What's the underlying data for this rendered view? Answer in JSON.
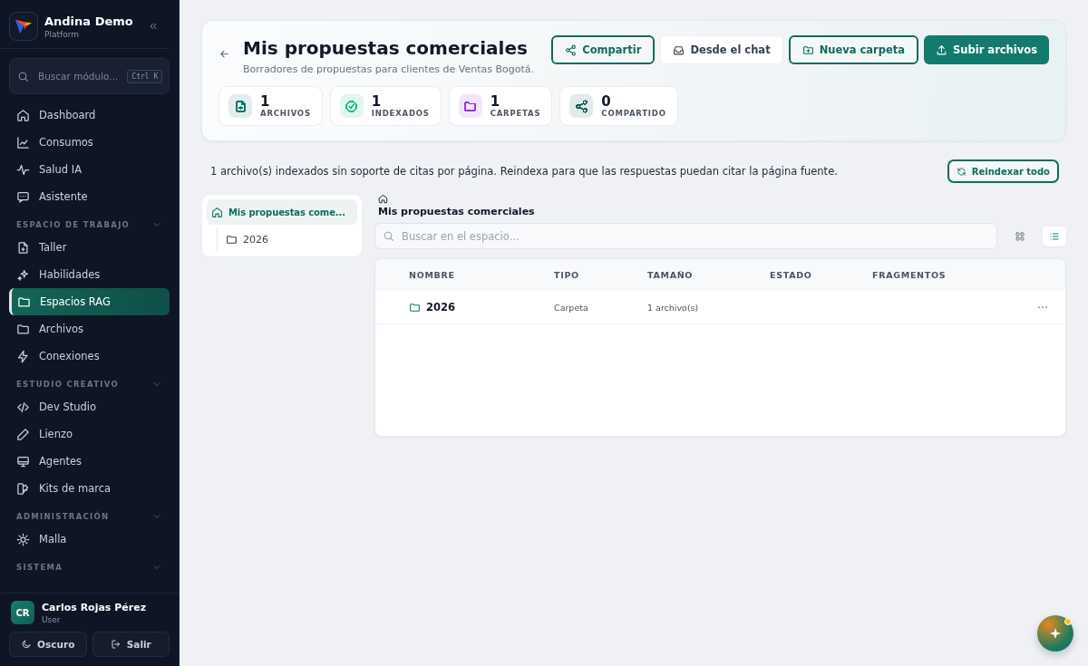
{
  "brand": {
    "name": "Andina Demo",
    "subtitle": "Platform"
  },
  "sidebar": {
    "search": {
      "placeholder": "Buscar módulo...",
      "shortcut": "Ctrl K"
    },
    "items": [
      {
        "label": "Dashboard",
        "selected": false
      },
      {
        "label": "Consumos",
        "selected": false
      },
      {
        "label": "Salud IA",
        "selected": false
      },
      {
        "label": "Asistente",
        "selected": false
      }
    ],
    "sections": [
      {
        "title": "ESPACIO DE TRABAJO",
        "expanded": true,
        "items": [
          {
            "label": "Taller",
            "selected": false
          },
          {
            "label": "Habilidades",
            "selected": false
          },
          {
            "label": "Espacios RAG",
            "selected": true
          },
          {
            "label": "Archivos",
            "selected": false
          },
          {
            "label": "Conexiones",
            "selected": false
          }
        ]
      },
      {
        "title": "ESTUDIO CREATIVO",
        "expanded": true,
        "items": [
          {
            "label": "Dev Studio",
            "selected": false
          },
          {
            "label": "Lienzo",
            "selected": false
          },
          {
            "label": "Agentes",
            "selected": false
          },
          {
            "label": "Kits de marca",
            "selected": false
          }
        ]
      },
      {
        "title": "ADMINISTRACIÓN",
        "expanded": true,
        "items": [
          {
            "label": "Malla",
            "selected": false
          }
        ]
      },
      {
        "title": "SISTEMA",
        "expanded": true
      }
    ]
  },
  "user": {
    "initials": "CR",
    "name": "Carlos Rojas Pérez",
    "role": "User"
  },
  "footer_buttons": [
    "Oscuro",
    "Salir"
  ],
  "header": {
    "title": "Mis propuestas comerciales",
    "subtitle": "Borradores de propuestas para clientes de Ventas Bogotá.",
    "actions": [
      {
        "label": "Compartir",
        "kind": "outline"
      },
      {
        "label": "Desde el chat",
        "kind": "plain"
      },
      {
        "label": "Nueva carpeta",
        "kind": "outline"
      },
      {
        "label": "Subir archivos",
        "kind": "primary"
      }
    ],
    "stats": [
      {
        "value": "1",
        "label": "ARCHIVOS",
        "color": "#0f766e"
      },
      {
        "value": "1",
        "label": "INDEXADOS",
        "color": "#10b981"
      },
      {
        "value": "1",
        "label": "CARPETAS",
        "color": "#9333ea"
      },
      {
        "value": "0",
        "label": "COMPARTIDO",
        "color": "#115e59"
      }
    ]
  },
  "notice": {
    "text": "1 archivo(s) indexados sin soporte de citas por página. Reindexa para que las respuestas puedan citar la página fuente.",
    "button": "Reindexar todo"
  },
  "tree": [
    {
      "label": "Mis propuestas come...",
      "selected": true,
      "children": [
        {
          "label": "2026",
          "selected": false
        }
      ]
    }
  ],
  "breadcrumb": "Mis propuestas comerciales",
  "search": {
    "placeholder": "Buscar en el espacio..."
  },
  "view_toggle": [
    {
      "kind": "grid",
      "selected": false
    },
    {
      "kind": "list",
      "selected": true
    }
  ],
  "table": {
    "columns": [
      "NOMBRE",
      "TIPO",
      "TAMAÑO",
      "ESTADO",
      "FRAGMENTOS"
    ],
    "rows": [
      {
        "name": "2026",
        "type": "Carpeta",
        "size": "1 archivo(s)"
      }
    ]
  }
}
